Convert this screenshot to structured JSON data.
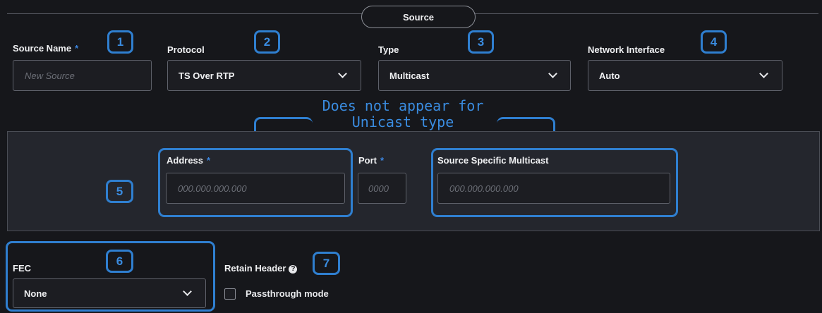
{
  "header": {
    "section_tab": "Source"
  },
  "fields": {
    "source_name": {
      "label": "Source Name",
      "required_mark": "*",
      "placeholder": "New Source"
    },
    "protocol": {
      "label": "Protocol",
      "value": "TS Over RTP"
    },
    "type": {
      "label": "Type",
      "value": "Multicast"
    },
    "network_interface": {
      "label": "Network Interface",
      "value": "Auto"
    },
    "address": {
      "label": "Address",
      "required_mark": "*",
      "placeholder": "000.000.000.000"
    },
    "port": {
      "label": "Port",
      "required_mark": "*",
      "placeholder": "0000"
    },
    "ssm": {
      "label": "Source Specific Multicast",
      "placeholder": "000.000.000.000"
    },
    "fec": {
      "label": "FEC",
      "value": "None"
    },
    "retain_header": {
      "label": "Retain Header",
      "help_icon": "?"
    },
    "passthrough": {
      "label": "Passthrough mode",
      "checked": false
    }
  },
  "annotations": {
    "numbers": [
      "1",
      "2",
      "3",
      "4",
      "5",
      "6",
      "7"
    ],
    "multicast_note_line1": "Does not appear for",
    "multicast_note_line2": "Unicast type"
  },
  "colors": {
    "background": "#16171b",
    "panel": "#24262d",
    "accent_blue": "#2f7fd0",
    "required_star": "#3b86e0"
  }
}
